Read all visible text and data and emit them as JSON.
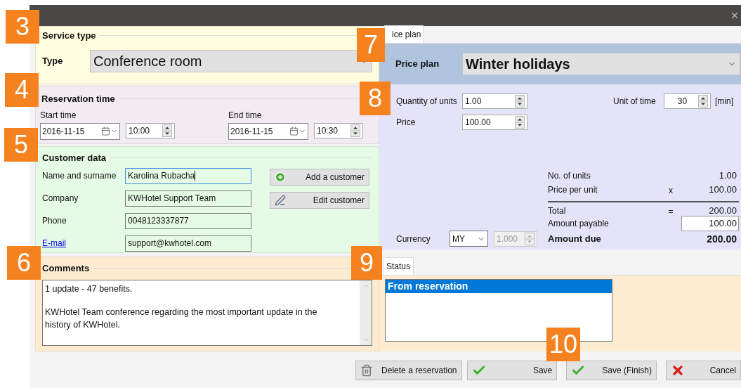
{
  "callouts": [
    {
      "label": "3"
    },
    {
      "label": "4"
    },
    {
      "label": "5"
    },
    {
      "label": "6"
    },
    {
      "label": "7"
    },
    {
      "label": "8"
    },
    {
      "label": "9"
    },
    {
      "label": "10"
    }
  ],
  "service_type": {
    "legend": "Service type",
    "type_label": "Type",
    "type_value": "Conference room"
  },
  "reservation_time": {
    "legend": "Reservation time",
    "start": {
      "label": "Start time",
      "date": "2016-11-15",
      "time": "10:00"
    },
    "end": {
      "label": "End time",
      "date": "2016-11-15",
      "time": "10:30"
    }
  },
  "customer": {
    "legend": "Customer data",
    "fields": [
      {
        "label": "Name and surname",
        "value": "Karolina Rubacha",
        "kind": "text",
        "focused": true
      },
      {
        "label": "Company",
        "value": "KWHotel Support Team",
        "kind": "text",
        "focused": false
      },
      {
        "label": "Phone",
        "value": "0048123337877",
        "kind": "text",
        "focused": false
      },
      {
        "label": "E-mail",
        "value": "support@kwhotel.com",
        "kind": "link",
        "focused": false
      }
    ],
    "buttons": [
      {
        "label": "Add a customer"
      },
      {
        "label": "Edit customer"
      }
    ]
  },
  "comments": {
    "legend": "Comments",
    "paragraphs": [
      "1 update - 47 benefits.",
      "KWHotel Team conference regarding the most important update in the history of KWHotel."
    ]
  },
  "price_tab": {
    "label": "ice plan",
    "selected": true
  },
  "price_plan": {
    "label": "Price plan",
    "value": "Winter holidays"
  },
  "quantity": {
    "label": "Quantity of units",
    "value": "1.00"
  },
  "price": {
    "label": "Price",
    "value": "100.00"
  },
  "unit_of_time": {
    "label": "Unit of time",
    "value": "30",
    "unit": "[min]"
  },
  "summary": [
    {
      "label": "No. of units",
      "value": "1.00",
      "kind": "plain"
    },
    {
      "label": "Price per unit",
      "operator": "x",
      "value": "100.00",
      "kind": "plain"
    },
    {
      "label": "Total",
      "operator": "=",
      "value": "200.00",
      "kind": "total"
    },
    {
      "label": "Amount payable",
      "value": "100.00",
      "kind": "input"
    },
    {
      "label": "Amount due",
      "value": "200.00",
      "kind": "bold"
    }
  ],
  "currency": {
    "label": "Currency",
    "value": "MY",
    "rate": "1.000",
    "rate_disabled": true
  },
  "status_tab": {
    "label": "Status",
    "selected": true
  },
  "status_list": [
    {
      "label": "From reservation",
      "selected": true
    }
  ],
  "footer_buttons": [
    {
      "label": "Delete a reservation"
    },
    {
      "label": "Save"
    },
    {
      "label": "Save (Finish)"
    },
    {
      "label": "Cancel"
    }
  ]
}
